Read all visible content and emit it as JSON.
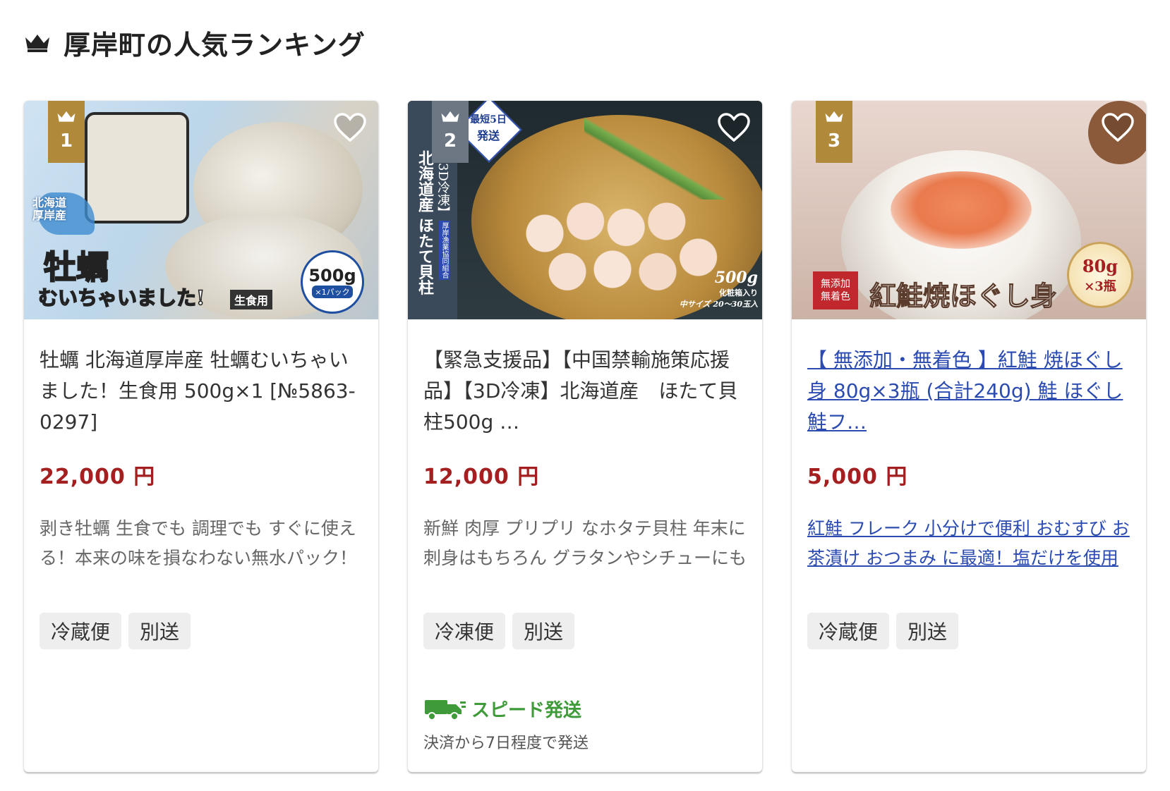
{
  "section": {
    "title": "厚岸町の人気ランキング",
    "icon": "crown-icon"
  },
  "items": [
    {
      "rank": "1",
      "rank_color": "#b08a3a",
      "image_text": {
        "badge_main": "牡蠣",
        "badge_sub": "むいちゃいました!",
        "usage": "生食用",
        "origin": "北海道\n厚岸産",
        "weight": "500g",
        "pack": "×1パック"
      },
      "title": "牡蠣 北海道厚岸産 牡蠣むいちゃいました！生食用 500g×1 [№5863-0297]",
      "price": "22,000 円",
      "description": "剥き牡蠣 生食でも 調理でも すぐに使える！本来の味を損なわない無水パック！",
      "tags": [
        "冷蔵便",
        "別送"
      ]
    },
    {
      "rank": "2",
      "rank_color": "#6d7784",
      "image_text": {
        "ship_badge_1": "最短5日",
        "ship_badge_2": "発送",
        "vertical_1": "【3D冷凍】",
        "vertical_2": "北海道産 ほたて貝柱",
        "vertical_3": "厚岸漁業協同組合",
        "weight": "500g",
        "box": "化粧箱入り",
        "size": "中サイズ 20〜30玉入"
      },
      "title": "【緊急支援品】【中国禁輸施策応援品】【3D冷凍】北海道産　ほたて貝柱500g …",
      "price": "12,000 円",
      "description": "新鮮 肉厚 プリプリ なホタテ貝柱 年末に刺身はもちろん グラタンやシチューにも",
      "tags": [
        "冷凍便",
        "別送"
      ],
      "speed_label": "スピード発送",
      "speed_note": "決済から7日程度で発送"
    },
    {
      "rank": "3",
      "rank_color": "#b08a3a",
      "image_text": {
        "badge_1": "無添加",
        "badge_2": "無着色",
        "name": "紅鮭焼ほぐし身",
        "weight": "80g",
        "count": "×3瓶"
      },
      "title": "【 無添加・無着色 】紅鮭 焼ほぐし身 80g×3瓶 (合計240g) 鮭 ほぐし 鮭フ…",
      "price": "5,000 円",
      "description": "紅鮭 フレーク 小分けで便利 おむすび お茶漬け おつまみ に最適！塩だけを使用",
      "tags": [
        "冷蔵便",
        "別送"
      ]
    }
  ]
}
